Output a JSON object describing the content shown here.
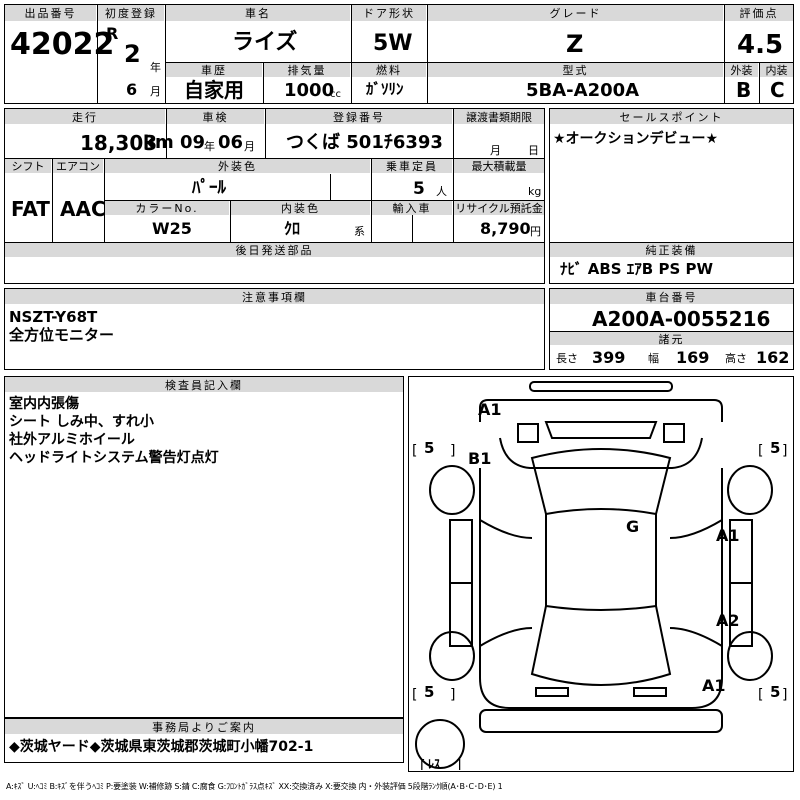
{
  "lot": {
    "label": "出品番号",
    "value": "42022"
  },
  "first_reg": {
    "label": "初度登録",
    "era": "R",
    "year": "2",
    "year_unit": "年",
    "month": "6",
    "month_unit": "月"
  },
  "car_name": {
    "label": "車名",
    "value": "ライズ"
  },
  "door": {
    "label": "ドア形状",
    "value": "5W"
  },
  "grade": {
    "label": "グレード",
    "value": "Z"
  },
  "score": {
    "label": "評価点",
    "value": "4.5",
    "ext_label": "外装",
    "int_label": "内装",
    "ext_value": "B",
    "int_value": "C"
  },
  "history": {
    "label": "車歴",
    "value": "自家用"
  },
  "displacement": {
    "label": "排気量",
    "value": "1000",
    "unit": "cc"
  },
  "fuel": {
    "label": "燃料",
    "value": "ｶﾞｿﾘﾝ"
  },
  "model_type": {
    "label": "型式",
    "value": "5BA-A200A"
  },
  "mileage": {
    "label": "走行",
    "value": "18,303",
    "unit": "km"
  },
  "inspection": {
    "label": "車検",
    "year": "09",
    "year_unit": "年",
    "month": "06",
    "month_unit": "月"
  },
  "plate": {
    "label": "登録番号",
    "value": "つくば 501ﾁ6393"
  },
  "transfer": {
    "label": "譲渡書類期限",
    "month_unit": "月",
    "day_unit": "日"
  },
  "sales_point": {
    "label": "セールスポイント",
    "text": "★オークションデビュー★"
  },
  "shift": {
    "label": "シフト",
    "value": "FAT"
  },
  "aircon": {
    "label": "エアコン",
    "value": "AAC"
  },
  "ext_color": {
    "label": "外装色",
    "value": "ﾊﾟｰﾙ"
  },
  "capacity": {
    "label": "乗車定員",
    "value": "5",
    "unit": "人"
  },
  "max_load": {
    "label": "最大積載量",
    "unit": "kg"
  },
  "color_no": {
    "label": "カラーNo.",
    "value": "W25"
  },
  "int_color": {
    "label": "内装色",
    "value": "ｸﾛ",
    "unit": "系"
  },
  "import": {
    "label": "輸入車"
  },
  "recycle": {
    "label": "リサイクル預託金",
    "value": "8,790",
    "unit": "円"
  },
  "later_parts": {
    "label": "後日発送部品"
  },
  "genuine": {
    "label": "純正装備",
    "value": "ﾅﾋﾞ ABS ｴｱB PS PW"
  },
  "notes": {
    "label": "注意事項欄",
    "lines": [
      "NSZT-Y68T",
      "全方位モニター"
    ]
  },
  "chassis": {
    "label": "車台番号",
    "value": "A200A-0055216"
  },
  "specs": {
    "label": "諸元",
    "length_label": "長さ",
    "length": "399",
    "width_label": "幅",
    "width": "169",
    "height_label": "高さ",
    "height": "162"
  },
  "inspector": {
    "label": "検査員記入欄",
    "lines": [
      "室内内張傷",
      "シート しみ中、すれ小",
      "社外アルミホイール",
      "ヘッドライトシステム警告灯点灯"
    ]
  },
  "office": {
    "label": "事務局よりご案内",
    "value": "◆茨城ヤード◆茨城県東茨城郡茨城町小幡702-1"
  },
  "diagram": {
    "marks": [
      "A1",
      "B1",
      "G",
      "A1",
      "A2",
      "A1"
    ],
    "tires": [
      "5",
      "5",
      "5",
      "5"
    ],
    "spare": "ﾚｽ"
  },
  "legend": "A:ｷｽﾞ U:ﾍｺﾐ B:ｷｽﾞを伴うﾍｺﾐ P:要塗装 W:補修跡 S:錆 C:腐食 G:ﾌﾛﾝﾄｶﾞﾗｽ点ｷｽﾞ XX:交換済み X:要交換 内・外装評価 5段階ﾗﾝｸ順(A･B･C･D･E) 1"
}
